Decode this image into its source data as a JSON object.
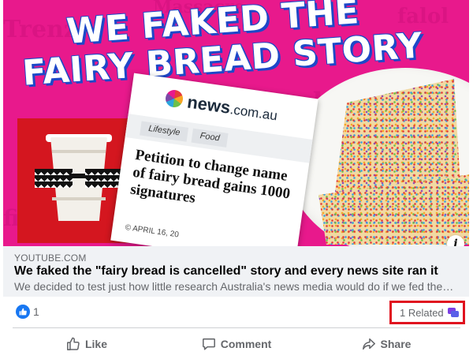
{
  "thumbnail": {
    "headline_line1": "WE FAKED THE",
    "headline_line2": "FAIRY BREAD STORY",
    "news_brand": "news",
    "news_brand_suffix": ".com.au",
    "crumbs": [
      "Lifestyle",
      "Food"
    ],
    "news_headline": "Petition to change name of fairy bread gains 1000 signatures",
    "news_date": "© APRIL 16, 20",
    "info_icon": "i"
  },
  "link_preview": {
    "domain": "YOUTUBE.COM",
    "title": "We faked the \"fairy bread is cancelled\" story and every news site ran it",
    "description": "We decided to test just how little research Australia's news media would do if we fed them a fa..."
  },
  "reactions": {
    "like_count": "1",
    "related_label": "1 Related"
  },
  "actions": {
    "like": "Like",
    "comment": "Comment",
    "share": "Share"
  },
  "colors": {
    "accent": "#1877f2",
    "highlight_border": "#e0121f",
    "muted_text": "#65676b",
    "thumbnail_pink": "#e8198c"
  },
  "icons": [
    "like-reaction-icon",
    "related-icon",
    "thumbs-up-icon",
    "comment-icon",
    "share-icon",
    "info-icon"
  ]
}
